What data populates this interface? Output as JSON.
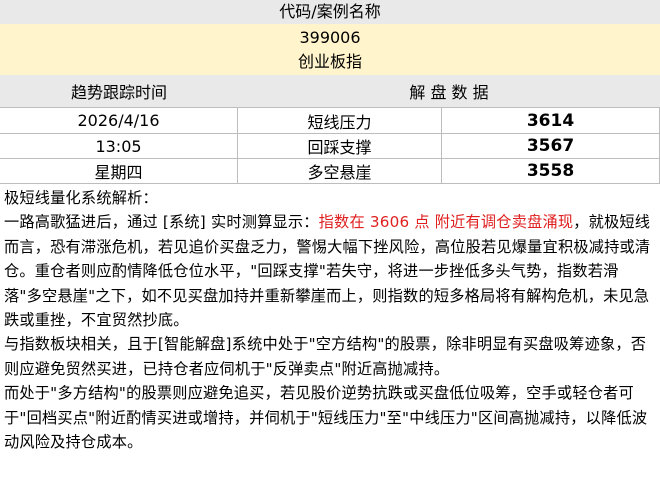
{
  "header": {
    "title": "代码/案例名称"
  },
  "stock": {
    "code": "399006",
    "name": "创业板指"
  },
  "table": {
    "left_header": "趋势跟踪时间",
    "right_header": "解 盘 数 据",
    "rows": [
      {
        "time": "2026/4/16",
        "label": "短线压力",
        "value": "3614"
      },
      {
        "time": "13:05",
        "label": "回踩支撑",
        "value": "3567"
      },
      {
        "time": "星期四",
        "label": "多空悬崖",
        "value": "3558"
      }
    ]
  },
  "analysis": {
    "title": "极短线量化系统解析：",
    "p1_start": "一路高歌猛进后，通过 [系统] 实时测算显示：",
    "p1_highlight": "指数在 3606 点 附近有调仓卖盘涌现",
    "p1_end": "，就极短线而言，恐有滞涨危机，若见追价买盘乏力，警惕大幅下挫风险，高位股若见爆量宜积极减持或清仓。重仓者则应酌情降低仓位水平，\"回踩支撑\"若失守，将进一步挫低多头气势，指数若滑落\"多空悬崖\"之下，如不见买盘加持并重新攀崖而上，则指数的短多格局将有解构危机，未见急跌或重挫，不宜贸然抄底。",
    "p2": "与指数板块相关，且于[智能解盘]系统中处于\"空方结构\"的股票，除非明显有买盘吸筹迹象，否则应避免贸然买进，已持仓者应伺机于\"反弹卖点\"附近高抛减持。",
    "p3": "而处于\"多方结构\"的股票则应避免追买，若见股价逆势抗跌或买盘低位吸筹，空手或轻仓者可于\"回档买点\"附近酌情买进或增持，并伺机于\"短线压力\"至\"中线压力\"区间高抛减持，以降低波动风险及持仓成本。"
  },
  "colors": {
    "header_bg": "#e9e9e9",
    "code_bg": "#fff4cc",
    "highlight": "#e02020"
  }
}
